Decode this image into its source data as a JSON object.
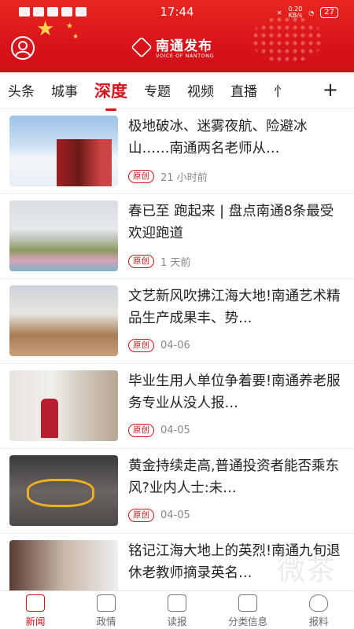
{
  "status_bar": {
    "time": "17:44",
    "net_speed_value": "0.20",
    "net_speed_unit": "KB/s",
    "battery": "27"
  },
  "header": {
    "brand_name": "南通发布",
    "brand_sub": "VOICE OF NANTONG",
    "colors": {
      "primary": "#d7141a"
    }
  },
  "tabs": [
    {
      "label": "头条",
      "active": false
    },
    {
      "label": "城事",
      "active": false
    },
    {
      "label": "深度",
      "active": true
    },
    {
      "label": "专题",
      "active": false
    },
    {
      "label": "视频",
      "active": false
    },
    {
      "label": "直播",
      "active": false
    },
    {
      "label": "忄",
      "active": false
    }
  ],
  "add_tab_label": "+",
  "articles": [
    {
      "title": "极地破冰、迷雾夜航、险避冰山……南通两名老师从…",
      "badge": "原创",
      "time": "21 小时前"
    },
    {
      "title": "春已至 跑起来 | 盘点南通8条最受欢迎跑道",
      "badge": "原创",
      "time": "1 天前"
    },
    {
      "title": "文艺新风吹拂江海大地!南通艺术精品生产成果丰、势…",
      "badge": "原创",
      "time": "04-06"
    },
    {
      "title": "毕业生用人单位争着要!南通养老服务专业从没人报…",
      "badge": "原创",
      "time": "04-05"
    },
    {
      "title": "黄金持续走高,普通投资者能否乘东风?业内人士:未…",
      "badge": "原创",
      "time": "04-05"
    },
    {
      "title": "铭记江海大地上的英烈!南通九旬退休老教师摘录英名…",
      "badge": "",
      "time": ""
    }
  ],
  "bottom_nav": [
    {
      "label": "新闻",
      "icon": "newspaper-icon",
      "active": true
    },
    {
      "label": "政情",
      "icon": "document-icon",
      "active": false
    },
    {
      "label": "读报",
      "icon": "book-icon",
      "active": false
    },
    {
      "label": "分类信息",
      "icon": "gift-icon",
      "active": false
    },
    {
      "label": "报料",
      "icon": "heart-icon",
      "active": false
    }
  ],
  "watermark": "微茶"
}
